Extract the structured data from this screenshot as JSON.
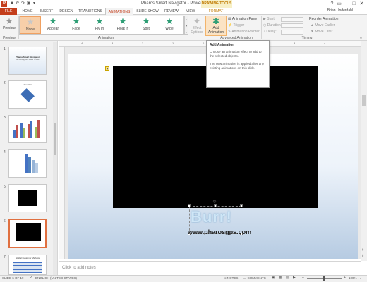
{
  "app": {
    "title": "Pharos Smart Navigator - PowerPoint",
    "context_group": "DRAWING TOOLS",
    "user": "Brian Underdahl"
  },
  "tabs": [
    "FILE",
    "HOME",
    "INSERT",
    "DESIGN",
    "TRANSITIONS",
    "ANIMATIONS",
    "SLIDE SHOW",
    "REVIEW",
    "VIEW",
    "FORMAT"
  ],
  "active_tab": "ANIMATIONS",
  "ribbon": {
    "preview_label": "Preview",
    "preview_group": "Preview",
    "animations": [
      "None",
      "Appear",
      "Fade",
      "Fly In",
      "Float In",
      "Split",
      "Wipe"
    ],
    "effect_options_label": "Effect Options",
    "animation_group": "Animation",
    "add_animation_label": "Add Animation",
    "animation_pane_label": "Animation Pane",
    "trigger_label": "Trigger",
    "animation_painter_label": "Animation Painter",
    "advanced_group": "Advanced Animation",
    "start_label": "Start:",
    "duration_label": "Duration:",
    "delay_label": "Delay:",
    "timing_group": "Timing",
    "reorder_label": "Reorder Animation",
    "move_earlier_label": "Move Earlier",
    "move_later_label": "Move Later"
  },
  "tooltip": {
    "title": "Add Animation",
    "line1": "Choose an animation effect to add to the selected objects.",
    "line2": "The new animation is applied after any existing animations on this slide."
  },
  "thumbnails": [
    {
      "num": "1",
      "title": "Pharos Smart Navigator",
      "subtitle": "GPS Navigation Made Simple"
    },
    {
      "num": "2",
      "title": "User Flow"
    },
    {
      "num": "3"
    },
    {
      "num": "4"
    },
    {
      "num": "5"
    },
    {
      "num": "6"
    },
    {
      "num": "7",
      "title": "Global Customer Markets"
    }
  ],
  "ruler_marks": [
    "4",
    "3",
    "2",
    "1",
    "0",
    "1",
    "2",
    "3",
    "4"
  ],
  "slide": {
    "burr_text": "Burr!",
    "url_text": "www.pharosgps.com"
  },
  "notes_placeholder": "Click to add notes",
  "status": {
    "slide_info": "SLIDE 6 OF 19",
    "language": "ENGLISH (UNITED STATES)",
    "notes_label": "NOTES",
    "comments_label": "COMMENTS",
    "zoom": "100%"
  },
  "colors": {
    "accent": "#c43e1c",
    "highlight": "#f7cfa9",
    "animation_star": "#2e9e75"
  }
}
